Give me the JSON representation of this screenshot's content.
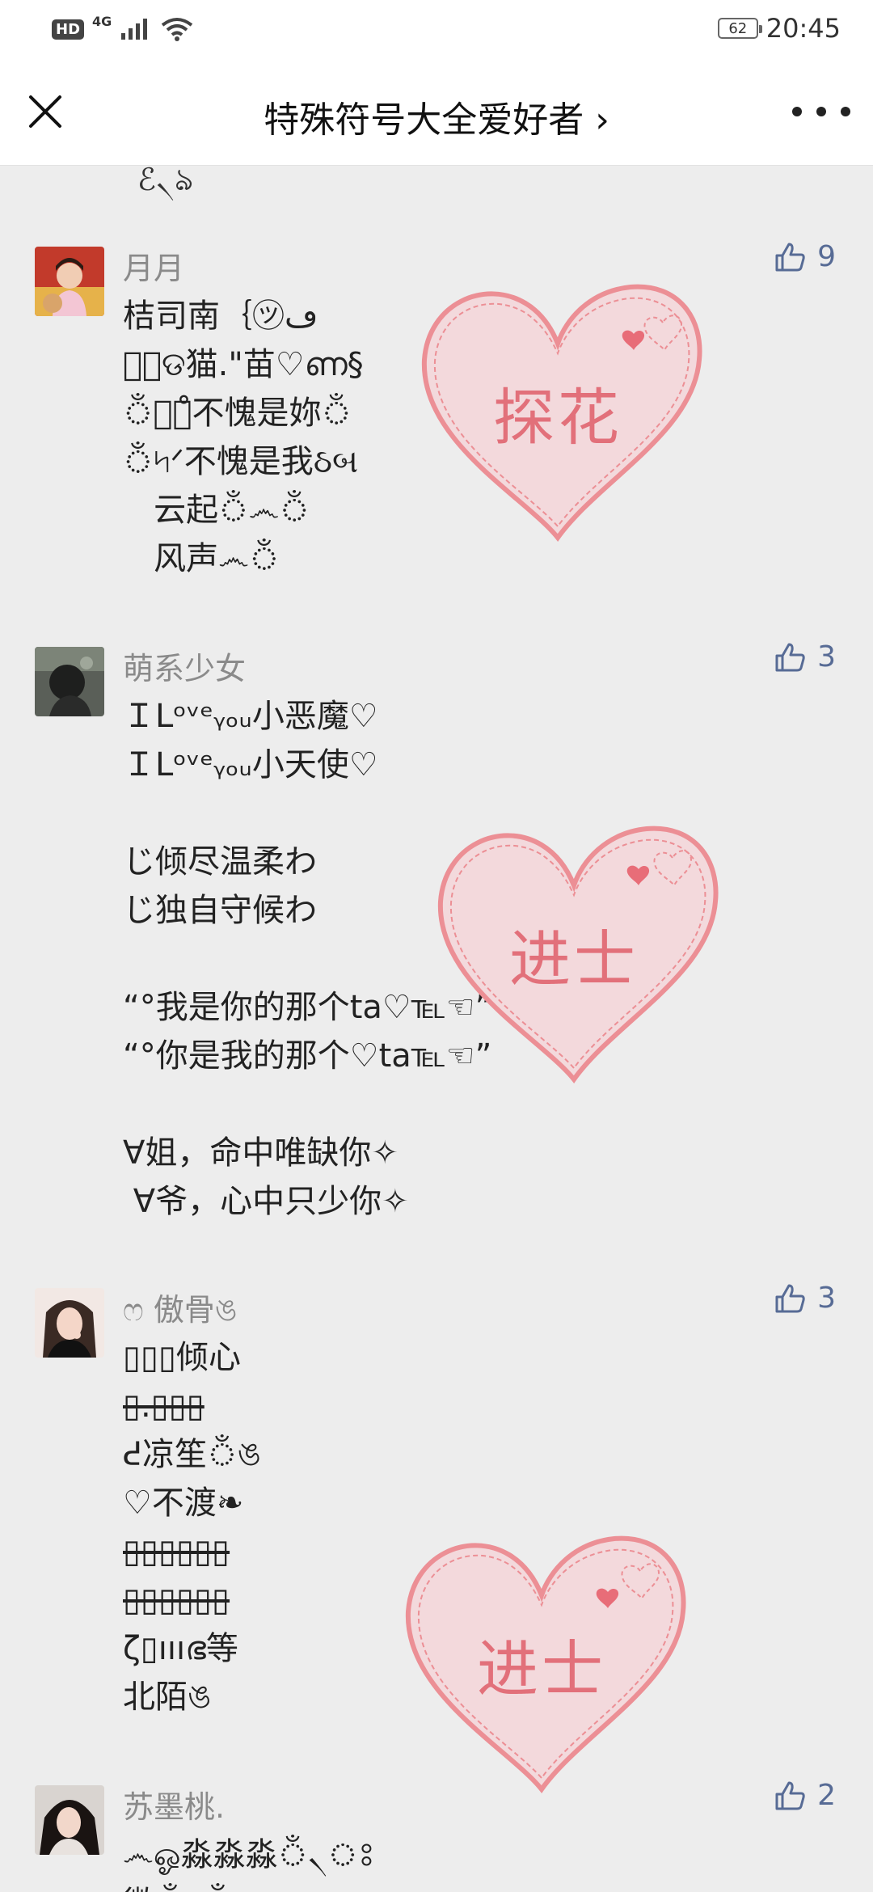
{
  "status_bar": {
    "hd": "HD",
    "network": "4G",
    "battery": "62",
    "time": "20:45"
  },
  "header": {
    "title": "特殊符号大全爱好者 ›"
  },
  "top_fragment": "ℰ৲ঌ",
  "comments": [
    {
      "name": "月月",
      "likes": "9",
      "lines": [
        "桔司南｛㋡ڡ",
        "ゝ᪶ଡ猫.\"苗♡ണ§",
        "ঁ৲ঃ̊不愧是妳ঁ",
        "ঁ৸ᐟ不愧是我ઠબ",
        "   云起ঁ෴ঁ",
        "   风声෴ঁ"
      ],
      "stamp": "探花"
    },
    {
      "name": "萌系少女",
      "likes": "3",
      "lines": [
        "ＩLᵒᵛᵉᵧₒᵤ小恶魔♡",
        "ＩLᵒᵛᵉᵧₒᵤ小天使♡",
        "",
        "じ倾尽温柔わ",
        "じ独自守候わ",
        "",
        "“°我是你的那个ta♡℡☜”",
        "“°你是我的那个♡ta℡☜”",
        "",
        "∀姐，命中唯缺你✧",
        " ∀爷，心中只少你✧"
      ],
      "stamp": "进士"
    },
    {
      "name": "ෆ 傲骨ঙ",
      "likes": "3",
      "lines": [
        "▯▯▯倾心",
        "▯.▯▯▯",
        "ᕍ凉笙ঁঙ",
        "♡不渡❧",
        "▯▯▯▯▯▯",
        "▯▯▯▯▯▯",
        "ζ▯ıııഭ等",
        "北陌ঙ"
      ],
      "stamp": "进士"
    },
    {
      "name": "苏墨桃.",
      "likes": "2",
      "lines": [
        "෴ஓ淼淼淼ঁ৲ঃ",
        "微ঁঃঁঃ"
      ]
    }
  ]
}
